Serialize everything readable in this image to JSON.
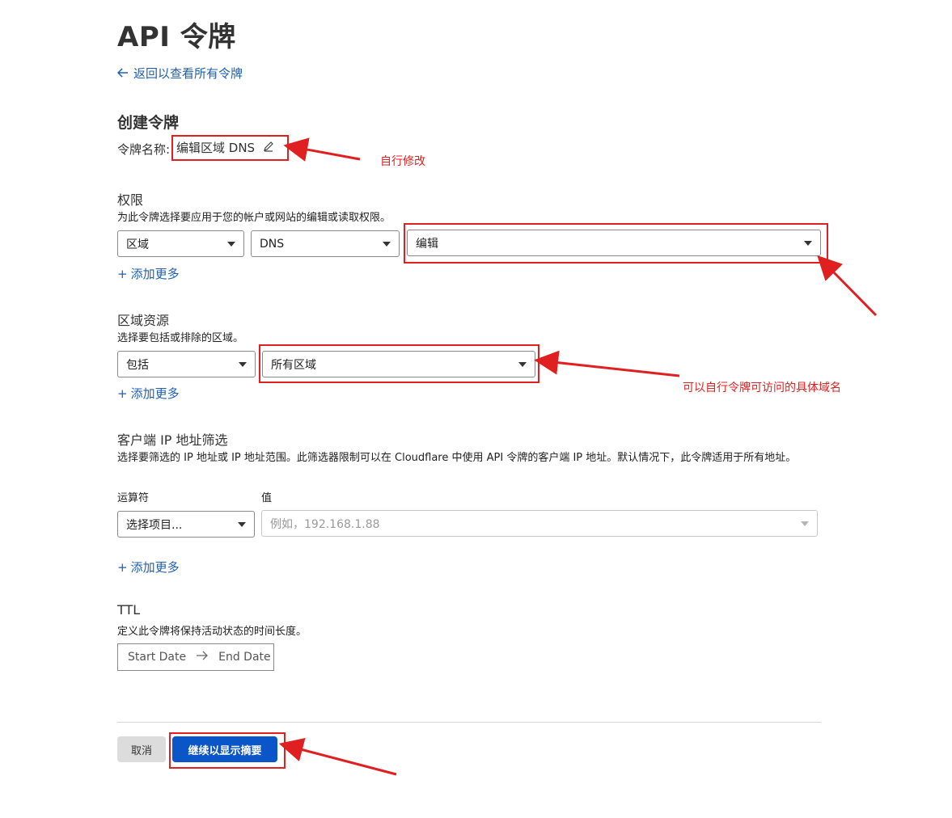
{
  "page": {
    "title": "API 令牌",
    "back_link": "返回以查看所有令牌"
  },
  "create": {
    "heading": "创建令牌",
    "name_label": "令牌名称:",
    "name_value": "编辑区域 DNS"
  },
  "permissions": {
    "heading": "权限",
    "description": "为此令牌选择要应用于您的帐户或网站的编辑或读取权限。",
    "scope": "区域",
    "resource": "DNS",
    "access": "编辑",
    "add_more": "添加更多"
  },
  "zone_resources": {
    "heading": "区域资源",
    "description": "选择要包括或排除的区域。",
    "mode": "包括",
    "target": "所有区域",
    "add_more": "添加更多"
  },
  "ip_filter": {
    "heading": "客户端 IP 地址筛选",
    "description": "选择要筛选的 IP 地址或 IP 地址范围。此筛选器限制可以在 Cloudflare 中使用 API 令牌的客户端 IP 地址。默认情况下，此令牌适用于所有地址。",
    "operator_label": "运算符",
    "value_label": "值",
    "operator_value": "选择项目...",
    "value_placeholder": "例如，192.168.1.88",
    "add_more": "添加更多"
  },
  "ttl": {
    "heading": "TTL",
    "description": "定义此令牌将保持活动状态的时间长度。",
    "start": "Start Date",
    "end": "End Date"
  },
  "actions": {
    "cancel": "取消",
    "continue": "继续以显示摘要"
  },
  "annotations": {
    "edit_name": "自行修改",
    "zone_tip": "可以自行令牌可访问的具体域名"
  },
  "colors": {
    "link": "#1f5fb0",
    "primary_button": "#0a55c8",
    "annotation": "#e02020"
  }
}
